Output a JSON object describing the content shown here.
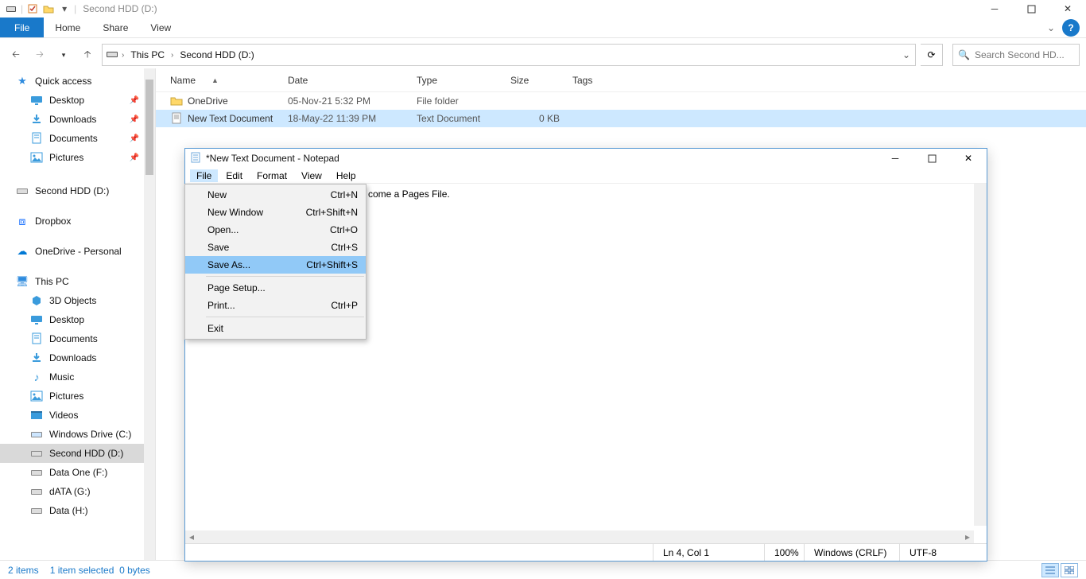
{
  "explorer": {
    "title": "Second HDD (D:)",
    "ribbon": {
      "file": "File",
      "home": "Home",
      "share": "Share",
      "view": "View"
    },
    "breadcrumbs": [
      "This PC",
      "Second HDD (D:)"
    ],
    "search_placeholder": "Search Second HD...",
    "columns": {
      "name": "Name",
      "date": "Date",
      "type": "Type",
      "size": "Size",
      "tags": "Tags"
    },
    "rows": [
      {
        "name": "OneDrive",
        "date": "05-Nov-21 5:32 PM",
        "type": "File folder",
        "size": "",
        "icon": "folder"
      },
      {
        "name": "New Text Document",
        "date": "18-May-22 11:39 PM",
        "type": "Text Document",
        "size": "0 KB",
        "icon": "textfile",
        "selected": true
      }
    ],
    "sidebar": {
      "quick_access": "Quick access",
      "qa_items": [
        {
          "label": "Desktop",
          "icon": "desktop",
          "pinned": true
        },
        {
          "label": "Downloads",
          "icon": "downloads",
          "pinned": true
        },
        {
          "label": "Documents",
          "icon": "documents",
          "pinned": true
        },
        {
          "label": "Pictures",
          "icon": "pictures",
          "pinned": true
        }
      ],
      "mid_items": [
        {
          "label": "Second HDD (D:)",
          "icon": "drive"
        },
        {
          "label": "Dropbox",
          "icon": "dropbox"
        },
        {
          "label": "OneDrive - Personal",
          "icon": "onedrive"
        }
      ],
      "thispc": "This PC",
      "pc_items": [
        {
          "label": "3D Objects",
          "icon": "3d"
        },
        {
          "label": "Desktop",
          "icon": "desktop"
        },
        {
          "label": "Documents",
          "icon": "documents"
        },
        {
          "label": "Downloads",
          "icon": "downloads"
        },
        {
          "label": "Music",
          "icon": "music"
        },
        {
          "label": "Pictures",
          "icon": "pictures"
        },
        {
          "label": "Videos",
          "icon": "videos"
        },
        {
          "label": "Windows Drive (C:)",
          "icon": "drive-win"
        },
        {
          "label": "Second HDD (D:)",
          "icon": "drive",
          "active": true
        },
        {
          "label": "Data One (F:)",
          "icon": "drive"
        },
        {
          "label": "dATA (G:)",
          "icon": "drive"
        },
        {
          "label": "Data (H:)",
          "icon": "drive"
        }
      ]
    },
    "status": {
      "items": "2 items",
      "selected": "1 item selected",
      "size": "0 bytes"
    }
  },
  "notepad": {
    "title": "*New Text Document - Notepad",
    "menus": {
      "file": "File",
      "edit": "Edit",
      "format": "Format",
      "view": "View",
      "help": "Help"
    },
    "visible_text_fragment": "come a Pages File.",
    "file_menu": [
      {
        "label": "New",
        "accel": "Ctrl+N"
      },
      {
        "label": "New Window",
        "accel": "Ctrl+Shift+N"
      },
      {
        "label": "Open...",
        "accel": "Ctrl+O"
      },
      {
        "label": "Save",
        "accel": "Ctrl+S"
      },
      {
        "label": "Save As...",
        "accel": "Ctrl+Shift+S",
        "highlight": true
      },
      {
        "sep": true
      },
      {
        "label": "Page Setup...",
        "accel": ""
      },
      {
        "label": "Print...",
        "accel": "Ctrl+P"
      },
      {
        "sep": true
      },
      {
        "label": "Exit",
        "accel": ""
      }
    ],
    "status": {
      "pos": "Ln 4, Col 1",
      "zoom": "100%",
      "eol": "Windows (CRLF)",
      "enc": "UTF-8"
    }
  }
}
